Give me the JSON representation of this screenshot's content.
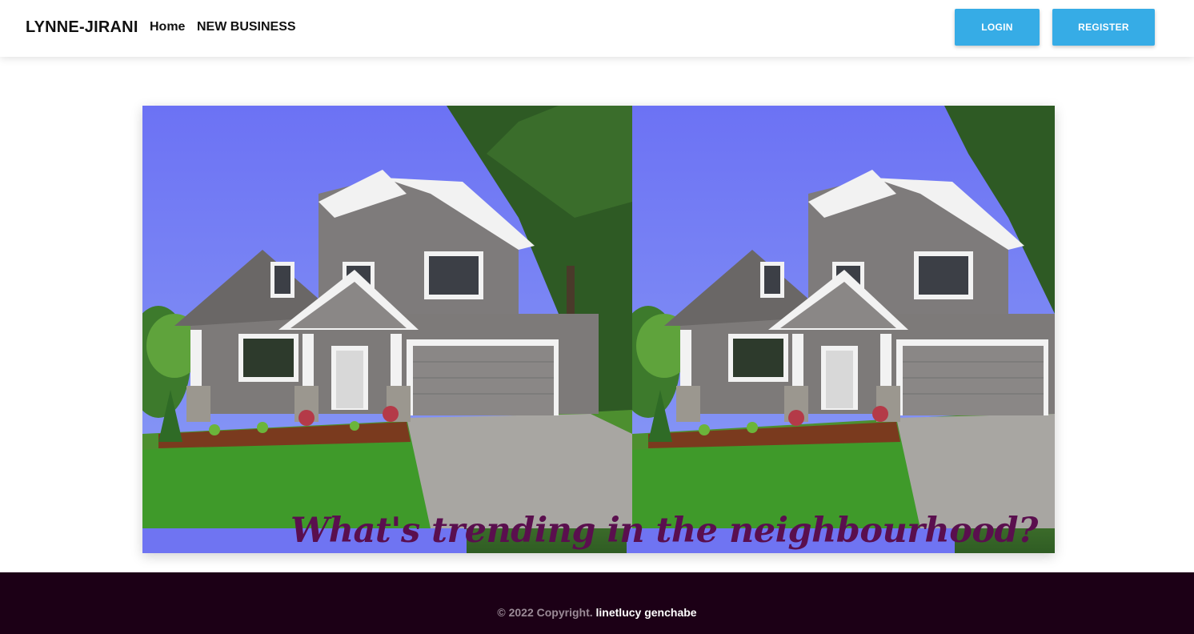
{
  "navbar": {
    "brand": "LYNNE-JIRANI",
    "links": [
      {
        "label": "Home"
      },
      {
        "label": "NEW BUSINESS"
      }
    ],
    "login_label": "LOGIN",
    "register_label": "REGISTER",
    "button_color": "#36ace6"
  },
  "hero": {
    "caption": "What's trending in the neighbourhood?",
    "caption_color": "#5a0f4e",
    "image_alt": "house-photo"
  },
  "footer": {
    "copyright": "© 2022 Copyright.",
    "author": "linetlucy genchabe",
    "background": "#1c0016"
  }
}
